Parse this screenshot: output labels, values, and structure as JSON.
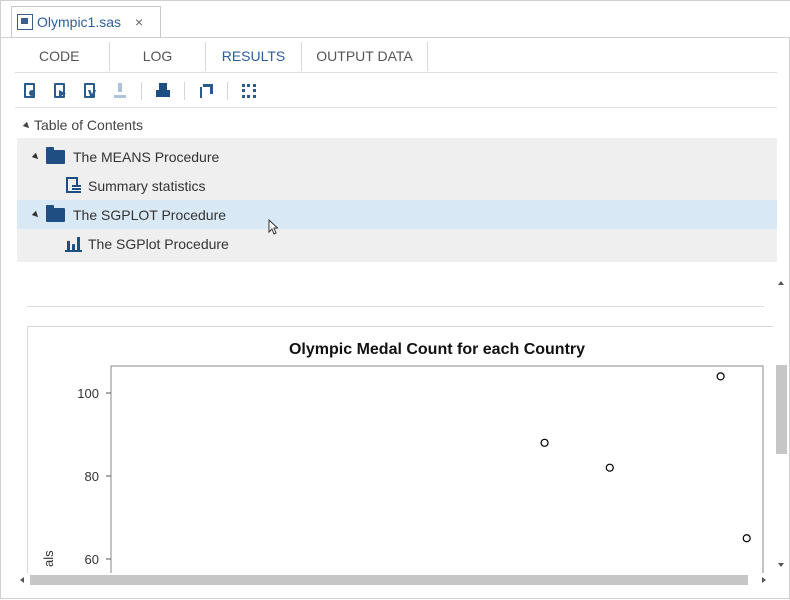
{
  "file_tab": {
    "name": "Olympic1.sas",
    "close": "×"
  },
  "subtabs": [
    "CODE",
    "LOG",
    "RESULTS",
    "OUTPUT DATA"
  ],
  "toolbar": {
    "icons": [
      "html-report-icon",
      "pdf-report-icon",
      "rtf-report-icon",
      "download-icon",
      "print-icon",
      "popout-icon",
      "maximize-icon"
    ]
  },
  "toc": {
    "title": "Table of Contents",
    "items": [
      {
        "label": "The MEANS Procedure",
        "children": [
          "Summary statistics"
        ]
      },
      {
        "label": "The SGPLOT Procedure",
        "children": [
          "The SGPlot Procedure"
        ]
      }
    ]
  },
  "chart_data": {
    "type": "scatter",
    "title": "Olympic Medal Count for each Country",
    "ylabel": "als",
    "xlabel": "",
    "yticks": [
      100,
      80,
      60
    ],
    "ylim": [
      55,
      106
    ],
    "xlim": [
      0,
      100
    ],
    "grid": false,
    "points": [
      {
        "x": 66.5,
        "y": 88
      },
      {
        "x": 76.5,
        "y": 82
      },
      {
        "x": 93.5,
        "y": 104
      },
      {
        "x": 97.5,
        "y": 65
      }
    ],
    "marker_color": "#000000"
  },
  "colors": {
    "accent": "#2c5f9e",
    "icon": "#1f4f82",
    "selected_row": "#d9e8f5",
    "toc_bg": "#efefef"
  }
}
